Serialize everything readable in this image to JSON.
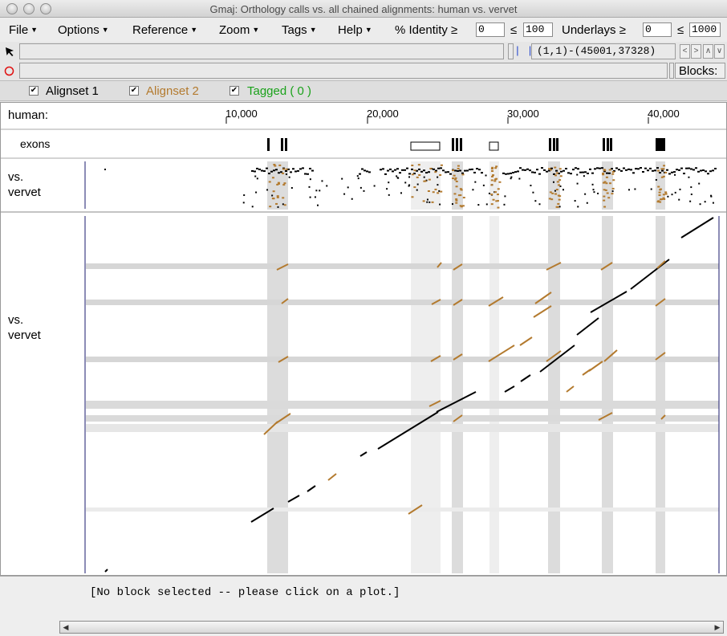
{
  "window": {
    "title": "Gmaj: Orthology calls vs. all chained alignments: human vs. vervet"
  },
  "menubar": {
    "menus": [
      "File",
      "Options",
      "Reference",
      "Zoom",
      "Tags",
      "Help"
    ],
    "identity_label": "% Identity ≥",
    "identity_min": "0",
    "identity_le": "≤",
    "identity_max": "100",
    "underlays_label": "Underlays ≥",
    "underlays_min": "0",
    "underlays_le": "≤",
    "underlays_max": "1000"
  },
  "toolbar": {
    "pointer_icon": "arrow-pointer-icon",
    "mark_icon": "red-circle-icon",
    "cursor_marker": "| |",
    "coords": "(1,1)-(45001,37328)",
    "blocks_label": "Blocks:"
  },
  "alignsets": [
    {
      "label": "Alignset 1",
      "color": "#000000",
      "checked": "✔"
    },
    {
      "label": "Alignset 2",
      "color": "#b37a2e",
      "checked": "✔"
    },
    {
      "label": "Tagged  ( 0 )",
      "color": "#1aa21a",
      "checked": "✔"
    }
  ],
  "plot": {
    "reference_label": "human:",
    "ruler_ticks": [
      "10,000",
      "20,000",
      "30,000",
      "40,000"
    ],
    "exons_label": "exons",
    "pip_label_line1": "vs.",
    "pip_label_line2": "vervet",
    "dot_label_line1": "vs.",
    "dot_label_line2": "vervet",
    "colors": {
      "alignset1": "#000000",
      "alignset2": "#b37a2e",
      "underlay": "#dcdcdc",
      "underlay_light": "#eeeeee"
    }
  },
  "status": {
    "message": "[No block selected -- please click on a plot.]"
  }
}
